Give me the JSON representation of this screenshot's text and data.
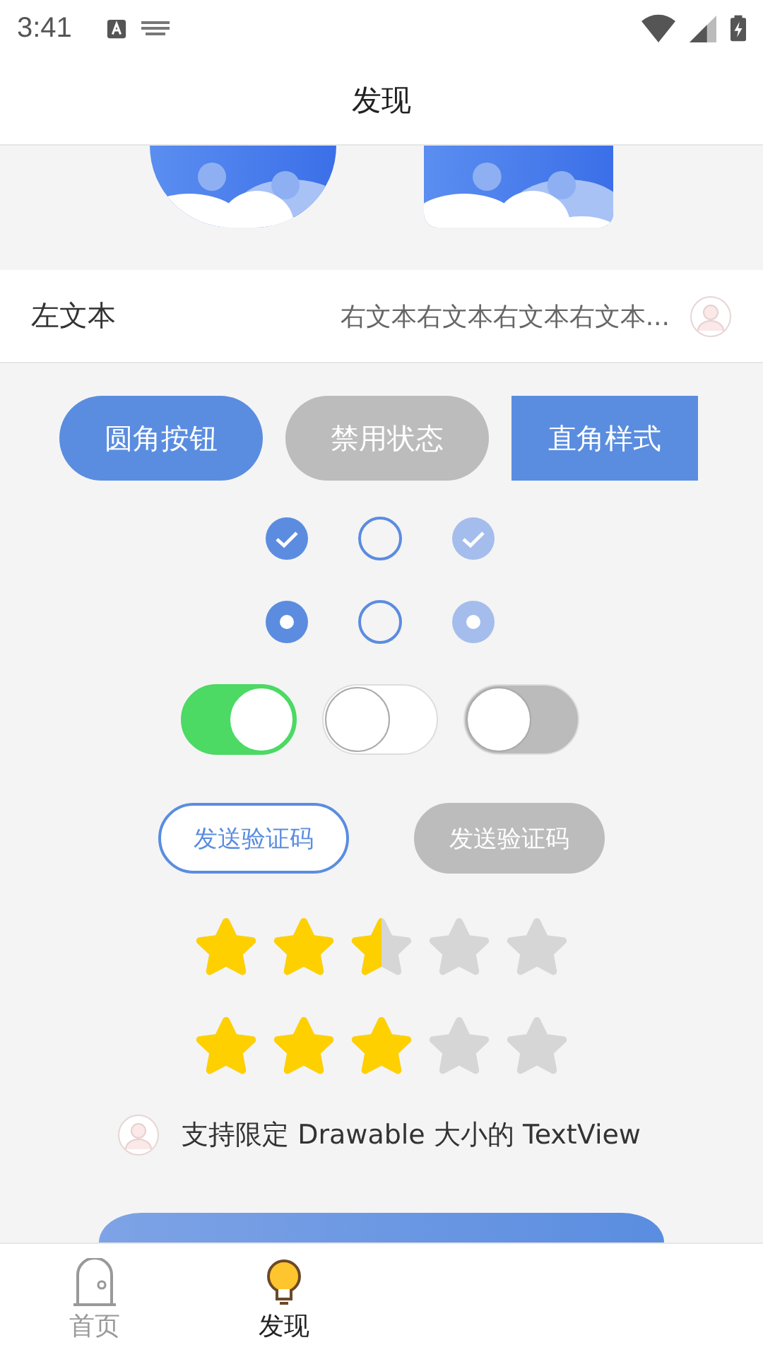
{
  "status_bar": {
    "time": "3:41"
  },
  "title": "发现",
  "images": [
    {
      "kind": "circle"
    },
    {
      "kind": "rounded"
    }
  ],
  "list_row": {
    "left": "左文本",
    "right": "右文本右文本右文本右文本..."
  },
  "buttons": [
    {
      "label": "圆角按钮",
      "kind": "round",
      "disabled": false
    },
    {
      "label": "禁用状态",
      "kind": "round",
      "disabled": true
    },
    {
      "label": "直角样式",
      "kind": "square",
      "disabled": false
    }
  ],
  "checkboxes": [
    {
      "checked": true,
      "disabled": false
    },
    {
      "checked": false,
      "disabled": false
    },
    {
      "checked": true,
      "disabled": true
    }
  ],
  "radios": [
    {
      "checked": true,
      "disabled": false
    },
    {
      "checked": false,
      "disabled": false
    },
    {
      "checked": true,
      "disabled": true
    }
  ],
  "switches": [
    {
      "on": true,
      "disabled": false
    },
    {
      "on": false,
      "disabled": false
    },
    {
      "on": false,
      "disabled": true
    }
  ],
  "code_buttons": [
    {
      "label": "发送验证码",
      "disabled": false
    },
    {
      "label": "发送验证码",
      "disabled": true
    }
  ],
  "ratings": [
    {
      "stars": 2.5
    },
    {
      "stars": 3
    }
  ],
  "drawable_text": "支持限定 Drawable 大小的 TextView",
  "bottom_nav": [
    {
      "label": "首页",
      "selected": false,
      "kind": "home"
    },
    {
      "label": "发现",
      "selected": true,
      "kind": "bulb"
    }
  ]
}
